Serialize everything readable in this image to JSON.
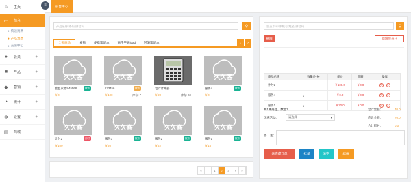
{
  "sidebar": {
    "home": "主页",
    "active_menu": "前台",
    "sub": [
      "快速消费",
      "产品消费",
      "充值中心"
    ],
    "items": [
      "会员",
      "产品",
      "营销",
      "统计",
      "设置",
      "商城"
    ]
  },
  "topbar": {
    "tab": "前台中心"
  },
  "product_search": {
    "placeholder": "产品名称/条码/拼音码"
  },
  "tabs": [
    "全部商品",
    "食物",
    "便携笔记本",
    "商用平板ipad",
    "轻薄笔记本"
  ],
  "products": [
    {
      "name": "喜巨家福S45568",
      "badge": "服务",
      "badge_color": "#1ab394",
      "price": "￥0",
      "stock": "",
      "image": "placeholder"
    },
    {
      "name": "123456",
      "badge": "服务",
      "badge_color": "#f0ad4e",
      "price": "￥100",
      "stock": "库存: 7",
      "image": "placeholder"
    },
    {
      "name": "电计计算器",
      "badge": "",
      "badge_color": "",
      "price": "￥20",
      "stock": "库存: 69",
      "image": "calculator"
    },
    {
      "name": "服务4",
      "badge": "服务",
      "badge_color": "#1ab394",
      "price": "￥0",
      "stock": "",
      "image": "placeholder"
    },
    {
      "name": "计时2",
      "badge": "计时",
      "badge_color": "#ed5565",
      "price": "￥100",
      "stock": "",
      "image": "placeholder"
    },
    {
      "name": "服务3",
      "badge": "服务",
      "badge_color": "#1ab394",
      "price": "￥20",
      "stock": "",
      "image": "placeholder"
    },
    {
      "name": "服务2",
      "badge": "服务",
      "badge_color": "#1ab394",
      "price": "￥22",
      "stock": "",
      "image": "placeholder"
    },
    {
      "name": "服务1",
      "badge": "服务",
      "badge_color": "#1ab394",
      "price": "￥15",
      "stock": "",
      "image": "placeholder"
    }
  ],
  "logo_text": "久久客",
  "pager": [
    "«",
    "‹",
    "1",
    "2",
    "3",
    "›",
    "»"
  ],
  "pager_active": "2",
  "member_search": {
    "placeholder": "会员卡号/手机号/姓名/拼音码"
  },
  "cart": {
    "delete": "删除",
    "add_member": "新增会员 +",
    "headers": [
      "商品名称",
      "数量/时长",
      "单价",
      "金额",
      "操作"
    ],
    "rows": [
      {
        "name": "计时2",
        "qty": "",
        "price": "￥100.0",
        "amount": "￥0.0"
      },
      {
        "name": "服务4",
        "qty": "1",
        "price": "￥0.0",
        "amount": "￥0.0"
      },
      {
        "name": "服务1",
        "qty": "1",
        "price": "￥20.0",
        "amount": "￥0.0"
      }
    ],
    "summary": "共1种商品，数量3",
    "total_label": "合计金额：",
    "total": "70.0",
    "discount_label": "优惠活动：",
    "discount_value": "请选择",
    "payable_label": "应收金额：",
    "payable": "70.0",
    "points_label": "合计积分：",
    "points": "0.0",
    "remark_label": "备　注："
  },
  "actions": {
    "hang": "未完成订单",
    "checkout": "挂单",
    "clear": "清空",
    "settle": "结帐"
  },
  "colors": {
    "accent": "#f59a23",
    "red": "#e65d4a",
    "blue": "#1c84c6",
    "teal": "#23c6c8"
  }
}
